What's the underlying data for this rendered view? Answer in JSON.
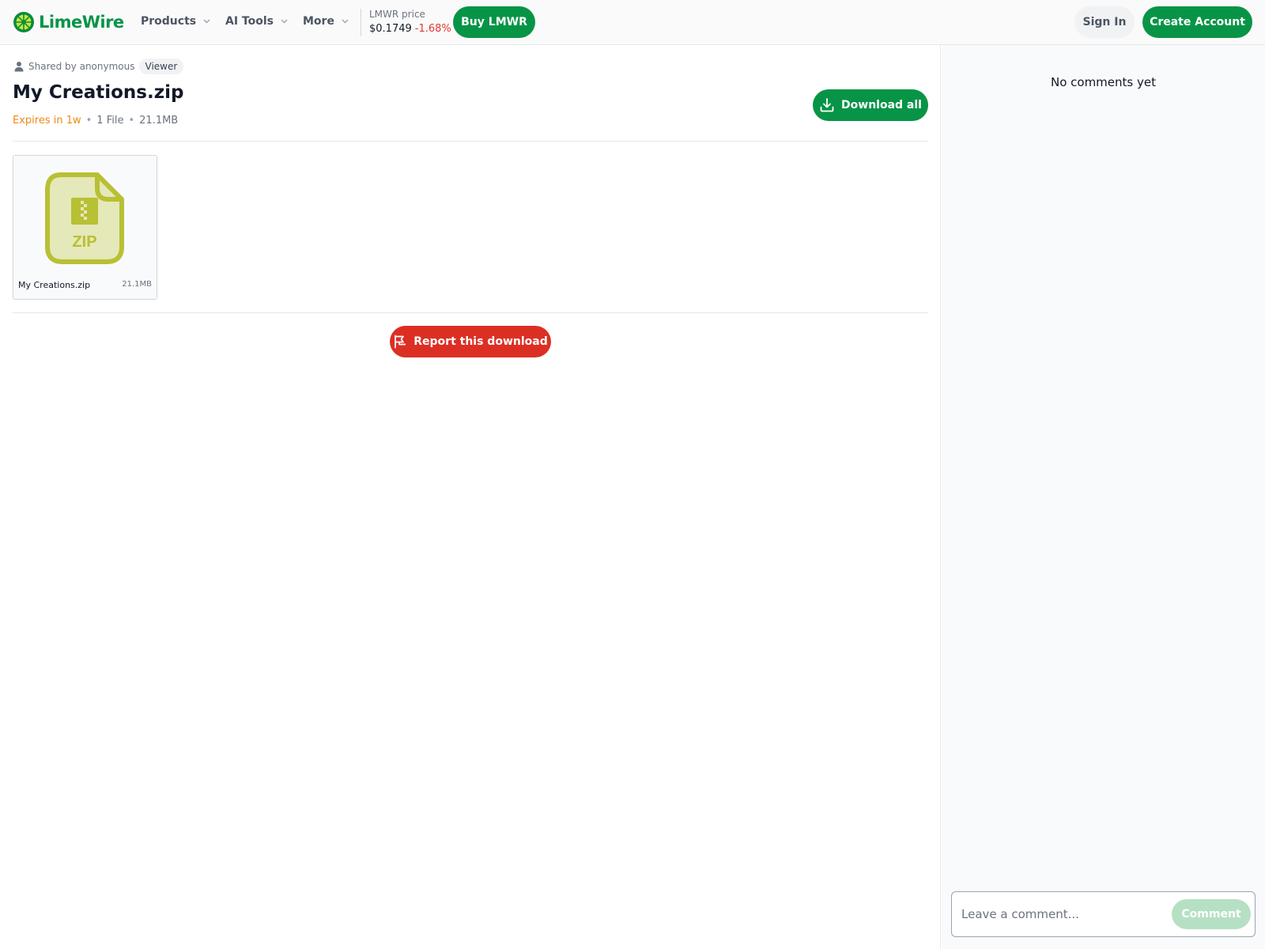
{
  "header": {
    "logo_text": "LimeWire",
    "nav": [
      {
        "label": "Products"
      },
      {
        "label": "AI Tools"
      },
      {
        "label": "More"
      }
    ],
    "price": {
      "label": "LMWR price",
      "value": "$0.1749",
      "change": "-1.68%"
    },
    "buy_label": "Buy LMWR",
    "signin_label": "Sign In",
    "create_label": "Create Account"
  },
  "share": {
    "shared_by": "Shared by anonymous",
    "role": "Viewer",
    "title": "My Creations.zip",
    "expires": "Expires in 1w",
    "file_count": "1 File",
    "total_size": "21.1MB",
    "download_all_label": "Download all"
  },
  "files": [
    {
      "name": "My Creations.zip",
      "size": "21.1MB",
      "type_label": "ZIP"
    }
  ],
  "report_label": "Report this download",
  "comments": {
    "empty_text": "No comments yet",
    "input_placeholder": "Leave a comment...",
    "submit_label": "Comment"
  },
  "colors": {
    "brand_green": "#089447",
    "danger_red": "#dc2f24",
    "expires_orange": "#ee8a14",
    "zip_icon": "#b8c034"
  },
  "icons": [
    "limewire-logo-icon",
    "chevron-down-icon",
    "user-icon",
    "download-icon",
    "zip-file-icon",
    "flag-icon"
  ]
}
